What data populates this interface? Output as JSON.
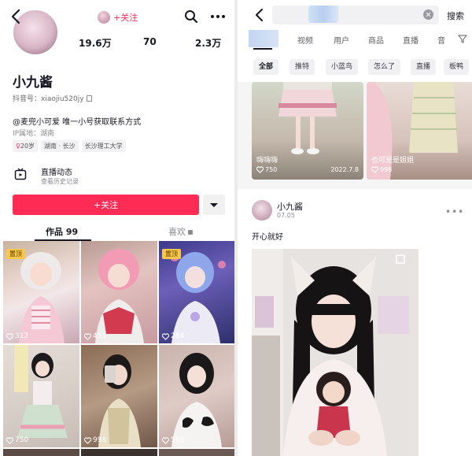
{
  "left": {
    "topbar": {
      "follow_label": "+关注"
    },
    "profile": {
      "stats": [
        "19.6万",
        "70",
        "2.3万"
      ],
      "name": "小九酱",
      "uid": "抖音号：xiaojiu520jy",
      "bio": "@麦兜小可爱 唯一小号获取联系方式",
      "ip": "IP属地：湖南",
      "tags": [
        "20岁",
        "湖南 · 长沙",
        "长沙理工大学"
      ]
    },
    "live": {
      "title": "直播动态",
      "subtitle": "查看历史记录"
    },
    "actions": {
      "follow_label": "+关注"
    },
    "tabs": {
      "works": "作品 99",
      "likes": "喜欢"
    },
    "grid": {
      "pinned_label": "置顶",
      "likes": [
        "312",
        "451",
        "284",
        "750",
        "998",
        "568"
      ]
    }
  },
  "right": {
    "search": {
      "button": "搜索"
    },
    "tabs": [
      "视频",
      "用户",
      "商品",
      "直播",
      "音"
    ],
    "chips": [
      "全部",
      "推特",
      "小蓝鸟",
      "怎么了",
      "直播",
      "板鸭"
    ],
    "cards": [
      {
        "title": "嗨嗨嗨",
        "likes": "750",
        "date": "2022.7.8"
      },
      {
        "title": "也可是是姐姐",
        "likes": "998",
        "date": ""
      }
    ],
    "post": {
      "name": "小九酱",
      "date": "07.05",
      "text": "开心就好"
    }
  },
  "colors": {
    "accent": "#fe2c55",
    "pinned": "#f9c84a"
  }
}
